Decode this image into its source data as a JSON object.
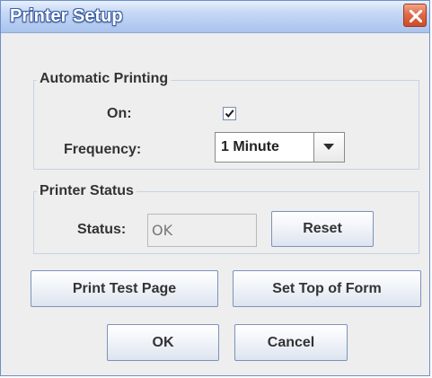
{
  "window": {
    "title": "Printer Setup",
    "close_symbol": "×"
  },
  "automatic_printing": {
    "group_title": "Automatic Printing",
    "on_label": "On:",
    "on_checked": true,
    "frequency_label": "Frequency:",
    "frequency_value": "1 Minute"
  },
  "printer_status": {
    "group_title": "Printer Status",
    "status_label": "Status:",
    "status_value": "OK",
    "reset_label": "Reset"
  },
  "actions": {
    "print_test_page_label": "Print Test Page",
    "set_top_of_form_label": "Set Top of Form",
    "ok_label": "OK",
    "cancel_label": "Cancel"
  },
  "icons": {
    "close": "close-icon",
    "checkmark": "checkmark-icon",
    "dropdown": "chevron-down-icon"
  },
  "colors": {
    "title_bar": "#a9c3ee",
    "close_button": "#e06b49",
    "panel_background": "#eeeeee",
    "group_border": "#c7d2e3"
  }
}
